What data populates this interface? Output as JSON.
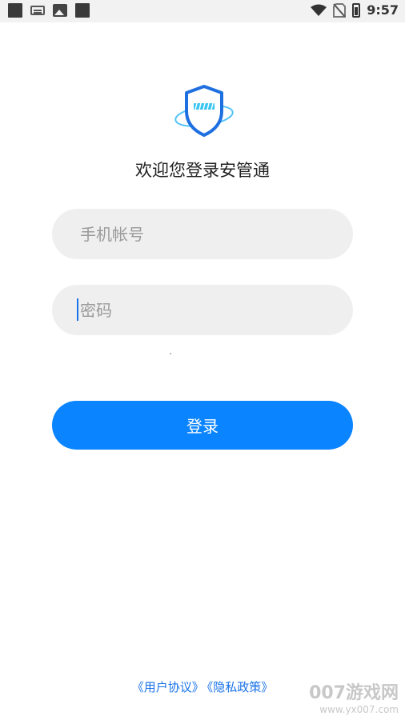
{
  "status_bar": {
    "time": "9:57",
    "icons": [
      "notification-square-icon",
      "keyboard-icon",
      "image-icon",
      "notification-square-icon",
      "wifi-icon",
      "no-sim-icon",
      "battery-charging-icon"
    ]
  },
  "login": {
    "welcome_title": "欢迎您登录安管通",
    "phone_placeholder": "手机帐号",
    "password_placeholder": "密码",
    "login_button": "登录"
  },
  "footer": {
    "user_agreement": "《用户协议》",
    "privacy_policy": "《隐私政策》"
  },
  "watermark": {
    "brand": "007游戏网",
    "url": "www.yx007.com"
  },
  "colors": {
    "primary": "#0a84ff",
    "link": "#1a73e8",
    "field_bg": "#efefef"
  }
}
